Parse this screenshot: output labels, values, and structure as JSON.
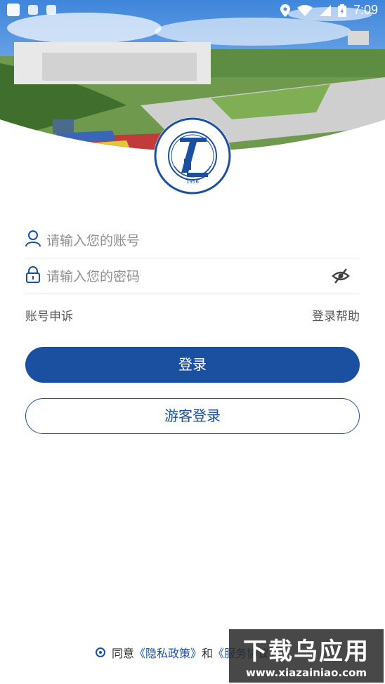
{
  "status_bar": {
    "time": "7:09"
  },
  "logo": {
    "year": "1956",
    "ring_text": "Jiangxi Vocational College Of Industry & Engineering"
  },
  "login": {
    "account_placeholder": "请输入您的账号",
    "password_placeholder": "请输入您的密码",
    "appeal_label": "账号申诉",
    "help_label": "登录帮助",
    "login_button": "登录",
    "guest_button": "游客登录"
  },
  "agreement": {
    "prefix": "同意",
    "privacy": "《隐私政策》",
    "and": "和",
    "terms": "《服务协议》"
  },
  "watermark": {
    "title": "下载乌应用",
    "url": "www.xiazainiao.com"
  },
  "colors": {
    "primary": "#1b50a0",
    "sky": "#4a8ee0"
  }
}
